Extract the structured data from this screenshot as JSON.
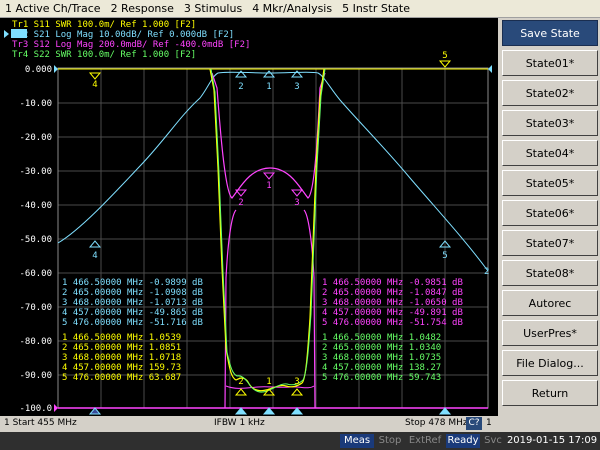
{
  "menu": [
    "1 Active Ch/Trace",
    "2 Response",
    "3 Stimulus",
    "4 Mkr/Analysis",
    "5 Instr State"
  ],
  "traces": [
    {
      "label": "Tr1 S11 SWR 100.0m/ Ref 1.000 [F2]",
      "color": "#ffff00"
    },
    {
      "label": "Tr2 S21 Log Mag 10.00dB/ Ref 0.000dB [F2]",
      "color": "#7fdfff",
      "active": true
    },
    {
      "label": "Tr3 S12 Log Mag 200.0mdB/ Ref -400.0mdB [F2]",
      "color": "#ff44ff"
    },
    {
      "label": "Tr4 S22 SWR 100.0m/ Ref 1.000 [F2]",
      "color": "#66ff66"
    }
  ],
  "yaxis": [
    "0.000",
    "-10.00",
    "-20.00",
    "-30.00",
    "-40.00",
    "-50.00",
    "-60.00",
    "-70.00",
    "-80.00",
    "-90.00",
    "-100.0"
  ],
  "marker_tables": {
    "cyan": [
      "1  466.50000 MHz -0.9899 dB",
      "2  465.00000 MHz -1.0908 dB",
      "3  468.00000 MHz -1.0713 dB",
      "4  457.00000 MHz -49.865 dB",
      "5  476.00000 MHz -51.716 dB"
    ],
    "yellow": [
      "1  466.50000 MHz  1.0539",
      "2  465.00000 MHz  1.0851",
      "3  468.00000 MHz  1.0718",
      "4  457.00000 MHz  159.73",
      "5  476.00000 MHz  63.687"
    ],
    "magenta": [
      "1  466.50000 MHz -0.9851 dB",
      "2  465.00000 MHz -1.0847 dB",
      "3  468.00000 MHz -1.0650 dB",
      "4  457.00000 MHz -49.891 dB",
      "5  476.00000 MHz -51.754 dB"
    ],
    "green": [
      "1  466.50000 MHz  1.0482",
      "2  465.00000 MHz  1.0340",
      "3  468.00000 MHz  1.0735",
      "4  457.00000 MHz  138.27",
      "5  476.00000 MHz  59.743"
    ]
  },
  "marker_labels": {
    "m1": "1",
    "m2": "2",
    "m3": "3",
    "m4": "4",
    "m5": "5"
  },
  "trace2_end_label": "2",
  "sidebar": [
    {
      "label": "Save State",
      "active": true
    },
    {
      "label": "State01*"
    },
    {
      "label": "State02*"
    },
    {
      "label": "State03*"
    },
    {
      "label": "State04*"
    },
    {
      "label": "State05*"
    },
    {
      "label": "State06*"
    },
    {
      "label": "State07*"
    },
    {
      "label": "State08*"
    },
    {
      "label": "Autorec"
    },
    {
      "label": "UserPres*"
    },
    {
      "label": "File Dialog..."
    },
    {
      "label": "Return"
    }
  ],
  "bottom": {
    "start": "1  Start 455 MHz",
    "ifbw": "IFBW 1 kHz",
    "stop": "Stop 478 MHz",
    "chan": "C?",
    "marker": "1"
  },
  "status": {
    "meas": "Meas",
    "stop": "Stop",
    "extref": "ExtRef",
    "ready": "Ready",
    "svc": "Svc",
    "datetime": "2019-01-15 17:09"
  },
  "colors": {
    "yellow": "#ffff00",
    "cyan": "#7fdfff",
    "magenta": "#ff44ff",
    "green": "#66ff66",
    "grid": "#4a4a4a"
  }
}
